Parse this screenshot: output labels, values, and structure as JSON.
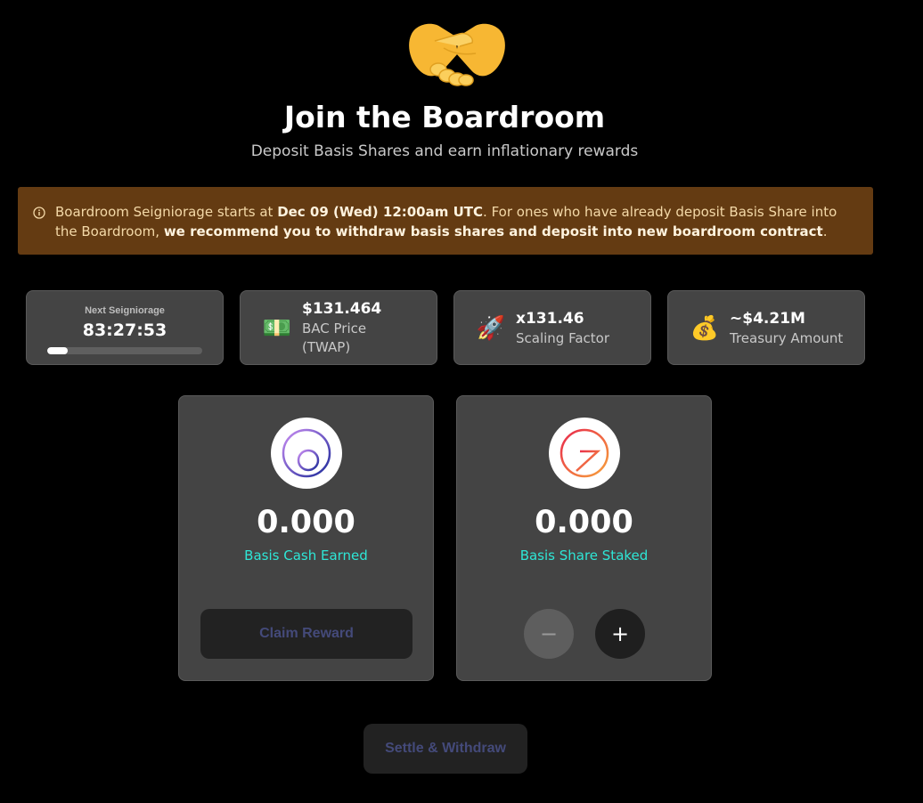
{
  "header": {
    "hero_icon": "handshake-icon",
    "title": "Join the Boardroom",
    "subtitle": "Deposit Basis Shares and earn inflationary rewards"
  },
  "notice": {
    "icon": "info-icon",
    "text_1": "Boardroom Seigniorage starts at ",
    "bold_1": "Dec 09 (Wed) 12:00am UTC",
    "text_2": ". For ones who have already deposit Basis Share into the Boardroom, ",
    "bold_2": "we recommend you to withdraw basis shares and deposit into new boardroom contract",
    "text_3": "."
  },
  "stats": {
    "countdown": {
      "label": "Next Seigniorage",
      "time": "83:27:53",
      "progress": 0.13
    },
    "bac_price": {
      "icon": "dollar-banknote-icon",
      "emoji": "💵",
      "value": "$131.464",
      "label": "BAC Price (TWAP)"
    },
    "scaling": {
      "icon": "rocket-icon",
      "emoji": "🚀",
      "value": "x131.46",
      "label": "Scaling Factor"
    },
    "treasury": {
      "icon": "money-bag-icon",
      "emoji": "💰",
      "value": "~$4.21M",
      "label": "Treasury Amount"
    }
  },
  "cards": {
    "earned": {
      "logo": "basis-cash-logo",
      "value": "0.000",
      "label": "Basis Cash Earned",
      "button": "Claim Reward"
    },
    "staked": {
      "logo": "basis-share-logo",
      "value": "0.000",
      "label": "Basis Share Staked",
      "minus": "−",
      "plus": "+"
    }
  },
  "footer": {
    "settle_button": "Settle & Withdraw"
  },
  "colors": {
    "accent_teal": "#2ee6d6",
    "notice_bg": "#643b12",
    "card_bg": "#444444",
    "disabled_text": "#444a7a"
  }
}
